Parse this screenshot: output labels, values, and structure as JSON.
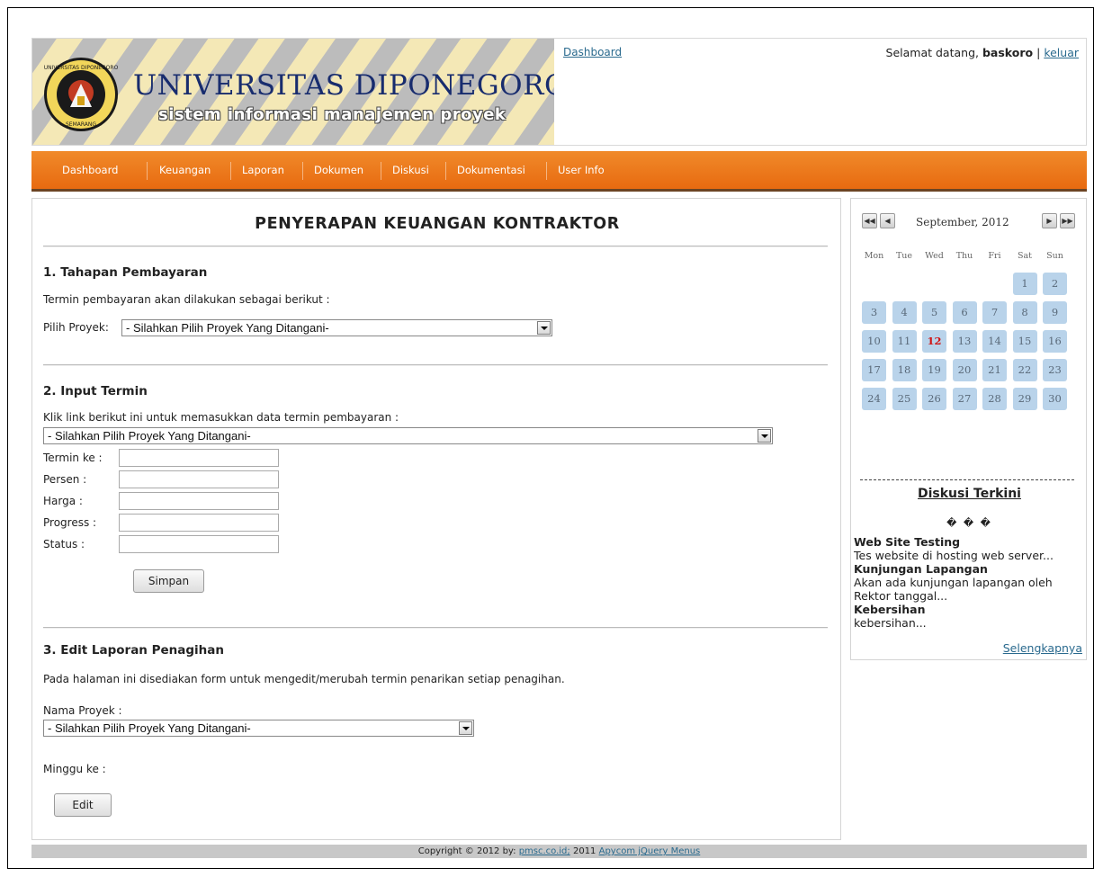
{
  "header": {
    "university": "UNIVERSITAS DIPONEGORO",
    "subtitle": "sistem informasi manajemen proyek",
    "link": "Dashboard",
    "welcome_prefix": "Selamat datang,",
    "username": "baskoro",
    "separator": "|",
    "logout": "keluar",
    "seal_text_top": "UNIVERSITAS DIPONEGORO",
    "seal_text_bottom": "SEMARANG"
  },
  "nav": [
    "Dashboard",
    "Keuangan",
    "Laporan",
    "Dokumen",
    "Diskusi",
    "Dokumentasi",
    "User Info"
  ],
  "main": {
    "title": "PENYERAPAN KEUANGAN KONTRAKTOR",
    "section1": {
      "heading": "1. Tahapan Pembayaran",
      "desc": "Termin pembayaran akan dilakukan sebagai berikut :",
      "select_label": "Pilih Proyek:",
      "select_value": "- Silahkan Pilih Proyek Yang Ditangani-"
    },
    "section2": {
      "heading": "2. Input Termin",
      "desc": "Klik link berikut ini untuk memasukkan data termin pembayaran :",
      "select_value": "- Silahkan Pilih Proyek Yang Ditangani-",
      "fields": [
        "Termin ke :",
        "Persen     :",
        "Harga      :",
        "Progress  :",
        "Status     :"
      ],
      "save_button": "Simpan"
    },
    "section3": {
      "heading": "3. Edit Laporan Penagihan",
      "desc": "Pada halaman ini disediakan form untuk mengedit/merubah termin penarikan setiap penagihan.",
      "name_label": "Nama Proyek :",
      "select_value": "- Silahkan Pilih Proyek Yang Ditangani-",
      "week_label": "Minggu ke :",
      "edit_button": "Edit"
    }
  },
  "calendar": {
    "month": "September, 2012",
    "weekdays": [
      "Mon",
      "Tue",
      "Wed",
      "Thu",
      "Fri",
      "Sat",
      "Sun"
    ],
    "today": 12,
    "days": [
      1,
      2,
      3,
      4,
      5,
      6,
      7,
      8,
      9,
      10,
      11,
      12,
      13,
      14,
      15,
      16,
      17,
      18,
      19,
      20,
      21,
      22,
      23,
      24,
      25,
      26,
      27,
      28,
      29,
      30
    ],
    "first_weekday_index": 5
  },
  "discussion": {
    "title": "Diskusi Terkini",
    "glyphs": "� � �",
    "items": [
      {
        "title": "Web Site Testing",
        "text": "Tes website di hosting web server..."
      },
      {
        "title": "Kunjungan Lapangan",
        "text": "Akan ada kunjungan lapangan oleh Rektor tanggal..."
      },
      {
        "title": "Kebersihan",
        "text": "kebersihan..."
      }
    ],
    "more": "Selengkapnya"
  },
  "footer": {
    "prefix": "Copyright © 2012 by:",
    "link1": "pmsc.co.id;",
    "middle": "2011",
    "link2": "Apycom jQuery Menus"
  }
}
